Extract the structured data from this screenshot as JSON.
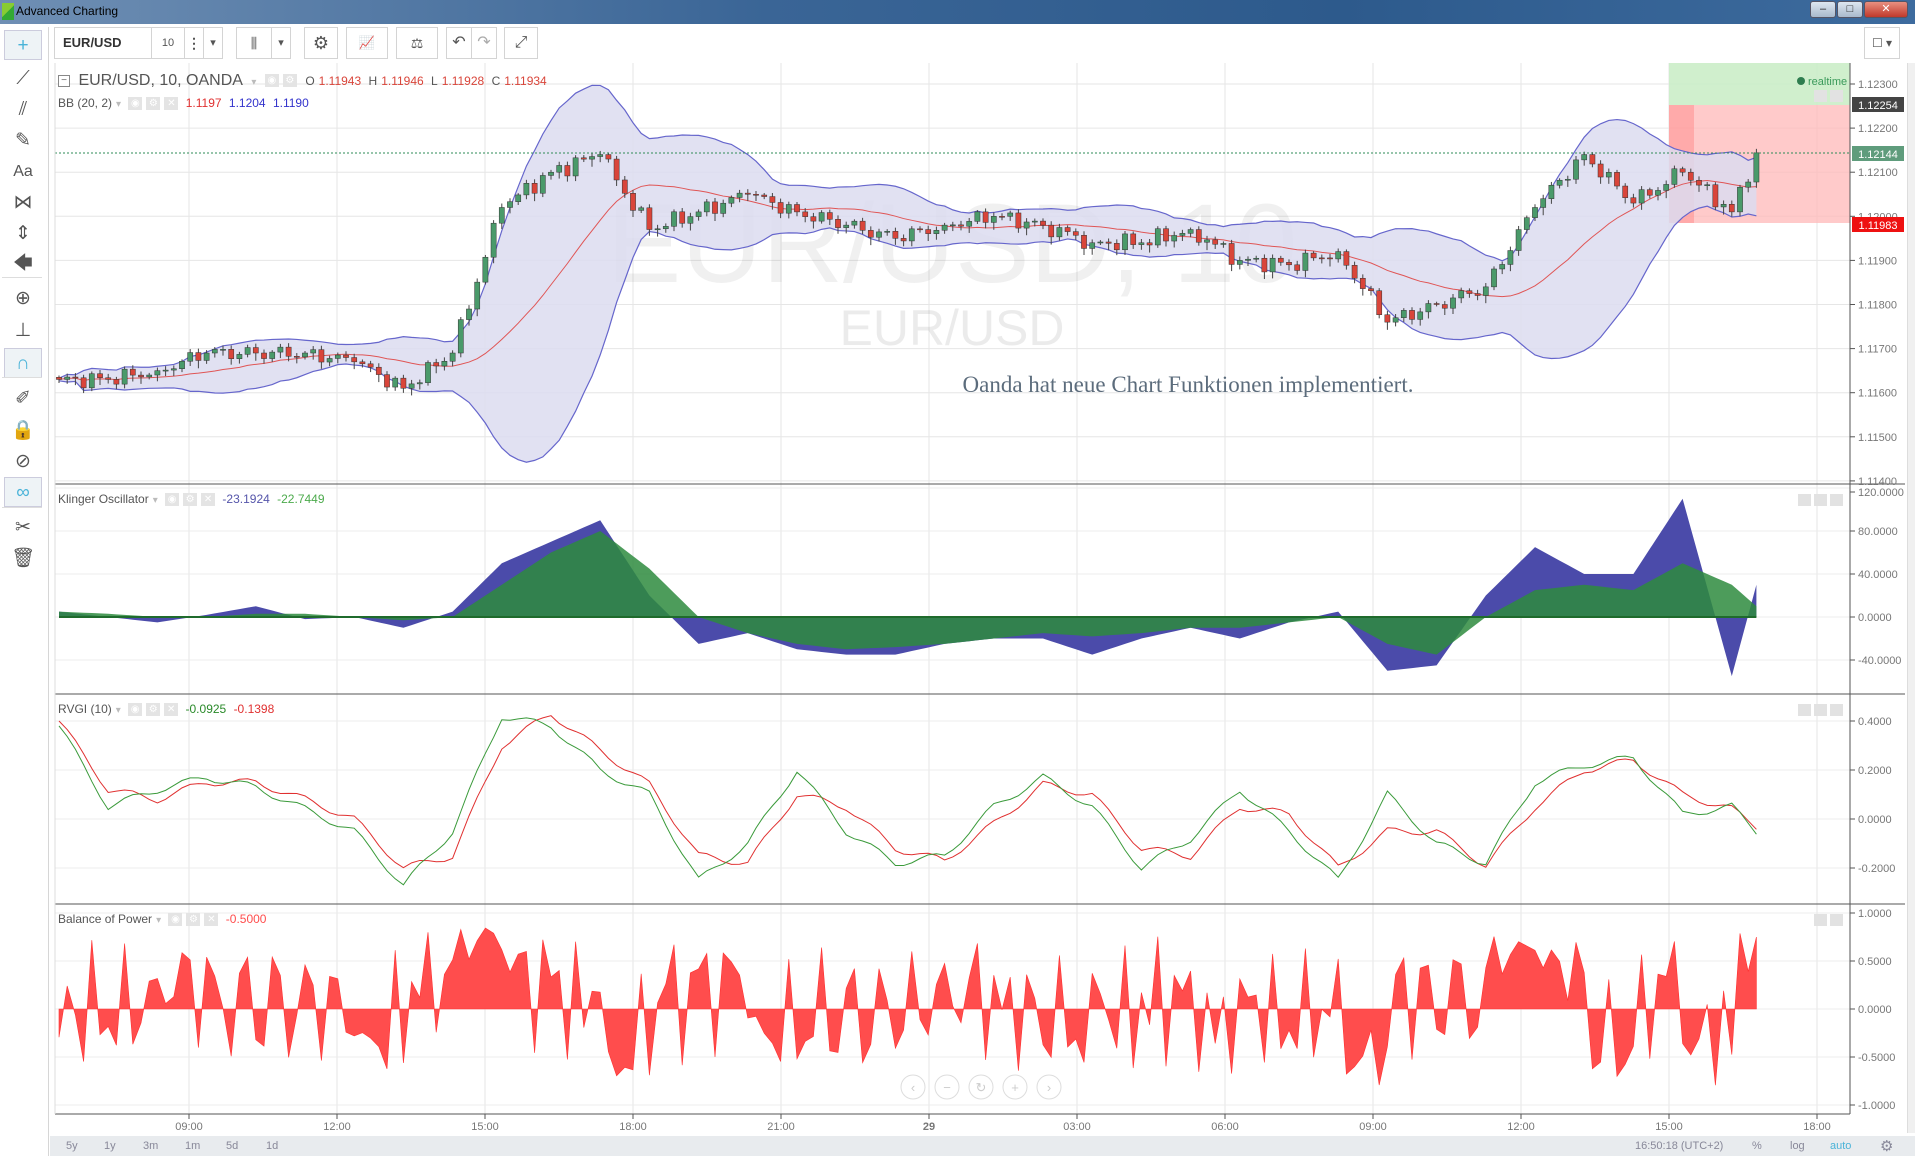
{
  "window": {
    "title": "Advanced Charting",
    "minimize": "–",
    "maximize": "□",
    "close": "✕"
  },
  "sidebar": {
    "items": [
      {
        "name": "crosshair",
        "glyph": "+"
      },
      {
        "name": "trend-line",
        "glyph": "⟋"
      },
      {
        "name": "pitchfork",
        "glyph": "⫽"
      },
      {
        "name": "brush",
        "glyph": "✎"
      },
      {
        "name": "text",
        "glyph": "Aa"
      },
      {
        "name": "pattern",
        "glyph": "⋈"
      },
      {
        "name": "measure",
        "glyph": "⇕"
      },
      {
        "name": "arrow",
        "glyph": "🡄"
      },
      {
        "name": "zoom",
        "glyph": "⊕"
      },
      {
        "name": "ruler",
        "glyph": "⊥"
      },
      {
        "name": "magnet",
        "glyph": "∩"
      },
      {
        "name": "stay-in-drawing",
        "glyph": "✐"
      },
      {
        "name": "lock",
        "glyph": "🔒"
      },
      {
        "name": "hide",
        "glyph": "⊘"
      },
      {
        "name": "link",
        "glyph": "∞"
      },
      {
        "name": "tools",
        "glyph": "✂"
      },
      {
        "name": "trash",
        "glyph": "🗑"
      }
    ]
  },
  "toolbar": {
    "symbol": "EUR/USD",
    "interval": "10",
    "more": "⋮",
    "dropdown": "▾",
    "chart_type": "⫼",
    "settings": "⚙",
    "indicators": "📈",
    "compare": "⚖",
    "undo": "↶",
    "redo": "↷",
    "fullscreen": "⤢",
    "layout": "☐ ▾"
  },
  "main": {
    "title": "EUR/USD, 10, OANDA",
    "ohlc": {
      "o_label": "O",
      "o": "1.11943",
      "h_label": "H",
      "h": "1.11946",
      "l_label": "L",
      "l": "1.11928",
      "c_label": "C",
      "c": "1.11934"
    },
    "bb": {
      "label": "BB (20, 2)",
      "mid": "1.1197",
      "upper": "1.1204",
      "lower": "1.1190"
    },
    "watermark1": "EUR/USD, 10",
    "watermark2": "EUR/USD",
    "annotation": "Oanda hat neue Chart Funktionen implementiert.",
    "realtime": "realtime",
    "price_labels": {
      "target": "1.12254",
      "last": "1.12144",
      "stop": "1.11983"
    }
  },
  "klinger": {
    "label": "Klinger Oscillator",
    "v1": "-23.1924",
    "v2": "-22.7449"
  },
  "rvgi": {
    "label": "RVGI (10)",
    "v1": "-0.0925",
    "v2": "-0.1398"
  },
  "bop": {
    "label": "Balance of Power",
    "v1": "-0.5000"
  },
  "bottom": {
    "ranges": [
      "5y",
      "1y",
      "3m",
      "1m",
      "5d",
      "1d"
    ],
    "clock": "16:50:18 (UTC+2)",
    "percent": "%",
    "log": "log",
    "auto": "auto",
    "gear": "⚙"
  },
  "colors": {
    "up": "#4a9a6a",
    "down": "#d9453a",
    "bb_band": "#6666cc",
    "bb_mid": "#e05555",
    "klinger": "#4b4baa",
    "klinger_signal": "#2e8b3e",
    "rvgi": "#3a9a3a",
    "rvgi_signal": "#e03030",
    "bop": "#ff4d4d",
    "accent": "#4ab3d8"
  },
  "chart_data": [
    {
      "type": "candlestick",
      "title": "EUR/USD, 10, OANDA",
      "x_ticks": [
        "09:00",
        "12:00",
        "15:00",
        "18:00",
        "21:00",
        "29",
        "03:00",
        "06:00",
        "09:00",
        "12:00",
        "15:00",
        "18:00"
      ],
      "y_ticks": [
        "1.12300",
        "1.12200",
        "1.12100",
        "1.12000",
        "1.11900",
        "1.11800",
        "1.11700",
        "1.11600",
        "1.11500",
        "1.11400"
      ],
      "ylim": [
        1.114,
        1.1232
      ],
      "hourly_times": [
        "06:20",
        "07:20",
        "08:20",
        "09:20",
        "10:20",
        "11:20",
        "12:20",
        "13:20",
        "14:20",
        "15:20",
        "16:20",
        "17:20",
        "18:20",
        "19:20",
        "20:20",
        "21:20",
        "22:20",
        "23:20",
        "00:20",
        "01:20",
        "02:20",
        "03:20",
        "04:20",
        "05:20",
        "06:20",
        "07:20",
        "08:20",
        "09:20",
        "10:20",
        "11:20",
        "12:20",
        "13:20",
        "14:20",
        "15:20",
        "16:20",
        "16:50"
      ],
      "hourly_close": [
        1.1163,
        1.1163,
        1.1165,
        1.1169,
        1.1169,
        1.1169,
        1.1167,
        1.1161,
        1.1169,
        1.1202,
        1.121,
        1.1214,
        1.1197,
        1.1201,
        1.1205,
        1.1201,
        1.1198,
        1.1195,
        1.1198,
        1.12,
        1.1198,
        1.1194,
        1.1194,
        1.1197,
        1.119,
        1.1189,
        1.1192,
        1.1176,
        1.118,
        1.1184,
        1.1202,
        1.1214,
        1.1203,
        1.121,
        1.1201,
        1.12144
      ],
      "indicator": "Bollinger Bands (20, 2)"
    },
    {
      "type": "area",
      "title": "Klinger Oscillator",
      "y_ticks": [
        "120.0000",
        "80.0000",
        "40.0000",
        "0.0000",
        "-40.0000"
      ],
      "ylim": [
        -62,
        122
      ],
      "series": [
        {
          "values": [
            5,
            0,
            -5,
            2,
            10,
            -2,
            0,
            -10,
            5,
            50,
            70,
            90,
            20,
            -25,
            -15,
            -30,
            -35,
            -35,
            -25,
            -20,
            -20,
            -35,
            -20,
            -10,
            -20,
            -5,
            5,
            -50,
            -45,
            20,
            65,
            40,
            40,
            110,
            -55,
            30
          ]
        },
        {
          "values": [
            5,
            3,
            0,
            0,
            3,
            3,
            0,
            -3,
            0,
            30,
            60,
            80,
            45,
            0,
            -15,
            -25,
            -30,
            -28,
            -25,
            -20,
            -15,
            -18,
            -15,
            -10,
            -10,
            -5,
            0,
            -25,
            -35,
            0,
            25,
            30,
            25,
            50,
            30,
            10
          ]
        }
      ]
    },
    {
      "type": "line",
      "title": "RVGI (10)",
      "y_ticks": [
        "0.4000",
        "0.2000",
        "0.0000",
        "-0.2000"
      ],
      "ylim": [
        -0.3,
        0.48
      ],
      "series": [
        {
          "values": [
            0.38,
            0.05,
            0.12,
            0.17,
            0.13,
            0.04,
            -0.05,
            -0.27,
            -0.05,
            0.42,
            0.38,
            0.2,
            0.1,
            -0.25,
            -0.1,
            0.2,
            -0.05,
            -0.18,
            -0.15,
            0.05,
            0.17,
            0.05,
            -0.2,
            -0.08,
            0.12,
            -0.05,
            -0.25,
            0.1,
            -0.1,
            -0.18,
            0.15,
            0.22,
            0.25,
            0.02,
            0.05,
            -0.05
          ]
        },
        {
          "values": [
            0.4,
            0.12,
            0.08,
            0.15,
            0.15,
            0.08,
            0.0,
            -0.2,
            -0.15,
            0.3,
            0.43,
            0.28,
            0.14,
            -0.15,
            -0.18,
            0.1,
            0.05,
            -0.12,
            -0.17,
            -0.02,
            0.14,
            0.1,
            -0.12,
            -0.15,
            0.05,
            0.02,
            -0.2,
            -0.05,
            -0.05,
            -0.19,
            0.05,
            0.2,
            0.24,
            0.1,
            0.04,
            -0.03
          ]
        }
      ]
    },
    {
      "type": "area",
      "title": "Balance of Power",
      "y_ticks": [
        "1.0000",
        "0.5000",
        "0.0000",
        "-0.5000",
        "-1.0000"
      ],
      "ylim": [
        -1.05,
        1.05
      ]
    }
  ]
}
